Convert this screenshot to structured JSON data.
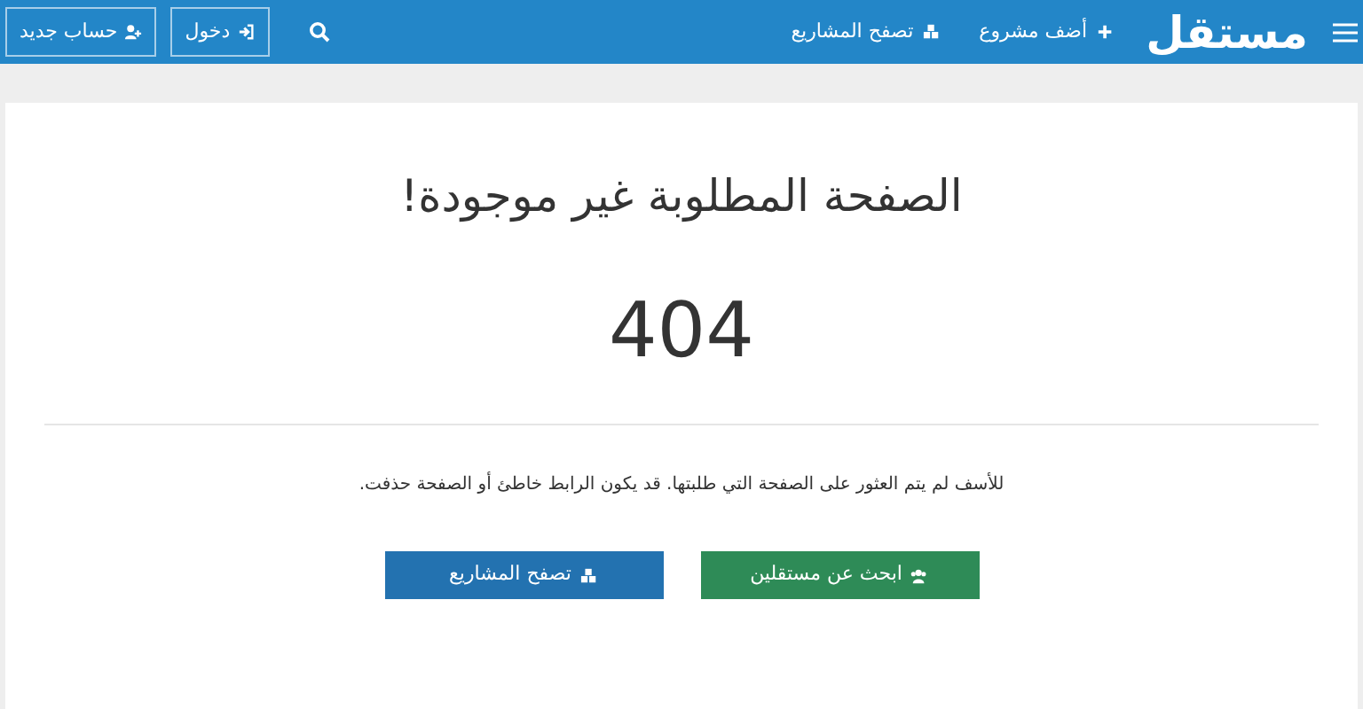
{
  "navbar": {
    "logo": "مستقل",
    "links": [
      {
        "label": "أضف مشروع"
      },
      {
        "label": "تصفح المشاريع"
      }
    ],
    "buttons": [
      {
        "label": "دخول"
      },
      {
        "label": "حساب جديد"
      }
    ]
  },
  "error": {
    "title": "الصفحة المطلوبة غير موجودة!",
    "code": "404",
    "message": "للأسف لم يتم العثور على الصفحة التي طلبتها. قد يكون الرابط خاطئ أو الصفحة حذفت.",
    "actions": [
      {
        "label": "ابحث عن مستقلين",
        "kind": "success"
      },
      {
        "label": "تصفح المشاريع",
        "kind": "primary"
      }
    ]
  }
}
